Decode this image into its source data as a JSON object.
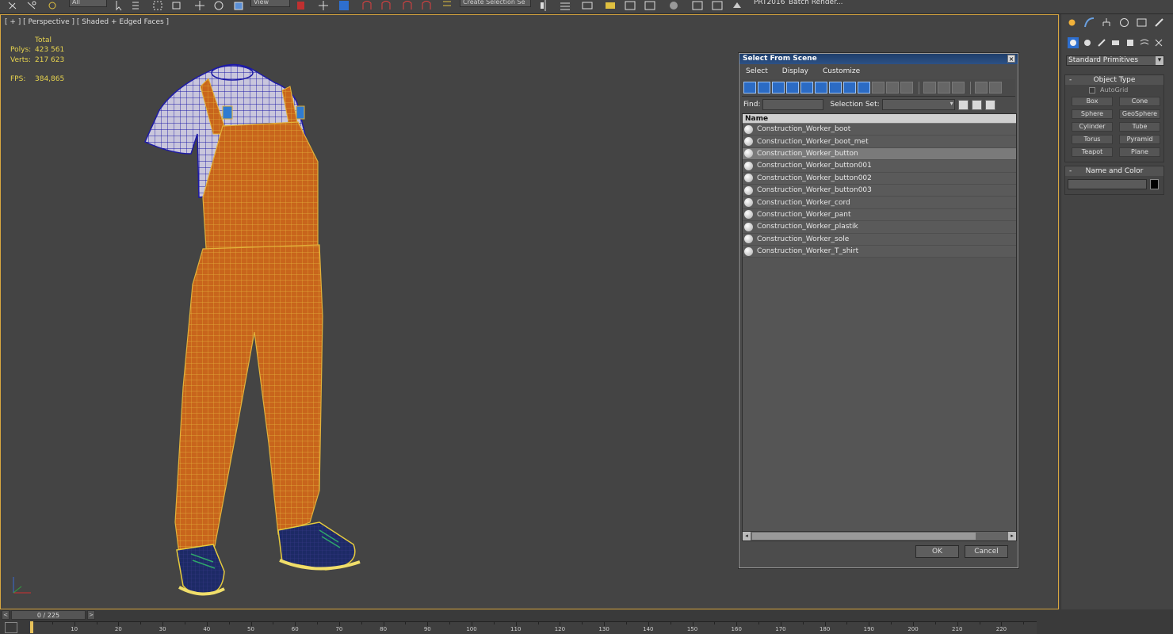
{
  "toolbar": {
    "dropdown_all": "All",
    "dropdown_view": "View",
    "dropdown_selection_set": "Create Selection Se",
    "text_prt": "PRT2016",
    "text_batch": "Batch Render..."
  },
  "viewport": {
    "label": "[ + ] [ Perspective ] [ Shaded + Edged Faces ]",
    "stats": {
      "total_label": "Total",
      "polys_label": "Polys:",
      "polys_value": "423 561",
      "verts_label": "Verts:",
      "verts_value": "217 623",
      "fps_label": "FPS:",
      "fps_value": "384,865"
    }
  },
  "dialog": {
    "title": "Select From Scene",
    "close": "×",
    "menu": [
      "Select",
      "Display",
      "Customize"
    ],
    "find_label": "Find:",
    "selection_set_label": "Selection Set:",
    "column_name": "Name",
    "items": [
      "Construction_Worker_boot",
      "Construction_Worker_boot_met",
      "Construction_Worker_button",
      "Construction_Worker_button001",
      "Construction_Worker_button002",
      "Construction_Worker_button003",
      "Construction_Worker_cord",
      "Construction_Worker_pant",
      "Construction_Worker_plastik",
      "Construction_Worker_sole",
      "Construction_Worker_T_shirt"
    ],
    "ok_label": "OK",
    "cancel_label": "Cancel"
  },
  "command_panel": {
    "primitives_dropdown": "Standard Primitives",
    "object_type_title": "Object Type",
    "autogrid_label": "AutoGrid",
    "objects": [
      "Box",
      "Cone",
      "Sphere",
      "GeoSphere",
      "Cylinder",
      "Tube",
      "Torus",
      "Pyramid",
      "Teapot",
      "Plane"
    ],
    "name_color_title": "Name and Color"
  },
  "timeline": {
    "frame_counter": "0 / 225",
    "ticks": [
      "10",
      "20",
      "30",
      "40",
      "50",
      "60",
      "70",
      "80",
      "90",
      "100",
      "110",
      "120",
      "130",
      "140",
      "150",
      "160",
      "170",
      "180",
      "190",
      "200",
      "210",
      "220"
    ]
  }
}
